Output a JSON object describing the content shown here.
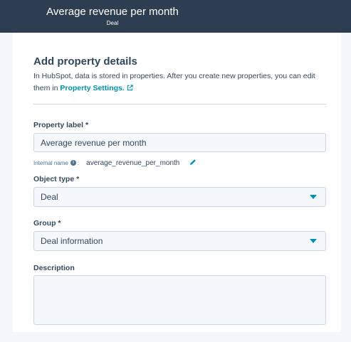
{
  "header": {
    "title": "Average revenue per month",
    "subtitle": "Deal"
  },
  "details": {
    "title": "Add property details",
    "intro_text": "In HubSpot, data is stored in properties. After you create new properties, you can edit them in ",
    "settings_link": "Property Settings."
  },
  "property_label": {
    "label": "Property label *",
    "value": "Average revenue per month",
    "internal_name_label": "Internal name",
    "internal_name_value": "average_revenue_per_month"
  },
  "object_type": {
    "label": "Object type *",
    "value": "Deal"
  },
  "group": {
    "label": "Group *",
    "value": "Deal information"
  },
  "description": {
    "label": "Description",
    "value": ""
  },
  "icons": {
    "info": "info-icon",
    "edit": "pencil-icon",
    "external_link": "external-link-icon",
    "dropdown": "caret-down-icon"
  },
  "colors": {
    "header_bg": "#2d3e50",
    "accent": "#0091ae",
    "field_bg": "#f5f8fa",
    "text": "#33475b"
  }
}
